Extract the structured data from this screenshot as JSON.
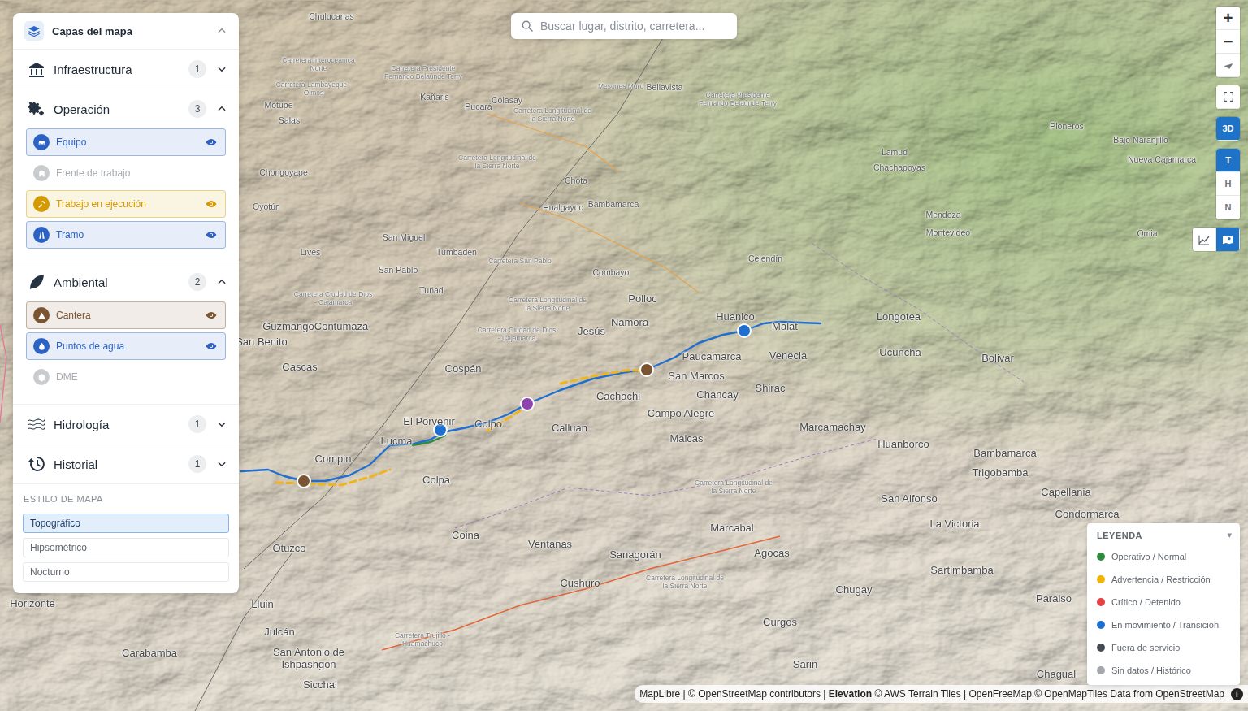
{
  "search": {
    "placeholder": "Buscar lugar, distrito, carretera..."
  },
  "layers_panel": {
    "title": "Capas del mapa",
    "expanded": true,
    "groups": [
      {
        "name": "Infraestructura",
        "count": "1",
        "expanded": false,
        "items": []
      },
      {
        "name": "Operación",
        "count": "3",
        "expanded": true,
        "items": [
          {
            "label": "Equipo",
            "on": true,
            "color": "#2c62c4"
          },
          {
            "label": "Frente de trabajo",
            "on": false,
            "color": "#b5b8bc"
          },
          {
            "label": "Trabajo en ejecución",
            "on": true,
            "color": "#d49a00"
          },
          {
            "label": "Tramo",
            "on": true,
            "color": "#2c62c4"
          }
        ]
      },
      {
        "name": "Ambiental",
        "count": "2",
        "expanded": true,
        "items": [
          {
            "label": "Cantera",
            "on": true,
            "color": "#7b5531"
          },
          {
            "label": "Puntos de agua",
            "on": true,
            "color": "#2c62c4"
          },
          {
            "label": "DME",
            "on": false,
            "color": "#b5b8bc"
          }
        ]
      },
      {
        "name": "Hidrología",
        "count": "1",
        "expanded": false,
        "items": []
      },
      {
        "name": "Historial",
        "count": "1",
        "expanded": false,
        "items": []
      }
    ],
    "map_style": {
      "title": "ESTILO DE MAPA",
      "options": [
        {
          "label": "Topográfico",
          "selected": true
        },
        {
          "label": "Hipsométrico",
          "selected": false
        },
        {
          "label": "Nocturno",
          "selected": false
        }
      ]
    }
  },
  "map_controls": {
    "zoom_in": "+",
    "zoom_out": "−",
    "modes": [
      {
        "label": "3D",
        "selected": true
      }
    ],
    "terrain": [
      {
        "label": "T",
        "selected": true
      },
      {
        "label": "H",
        "selected": false
      },
      {
        "label": "N",
        "selected": false
      }
    ],
    "tools": [
      {
        "selected": false
      },
      {
        "selected": true
      }
    ]
  },
  "legend": {
    "title": "LEYENDA",
    "toggle": "▾",
    "items": [
      {
        "label": "Operativo / Normal",
        "color": "#2e8b3e"
      },
      {
        "label": "Advertencia / Restricción",
        "color": "#f0b400"
      },
      {
        "label": "Crítico / Detenido",
        "color": "#e04444"
      },
      {
        "label": "En movimiento / Transición",
        "color": "#1f6fd0"
      },
      {
        "label": "Fuera de servicio",
        "color": "#454c56"
      },
      {
        "label": "Sin datos / Histórico",
        "color": "#a3a6aa"
      }
    ]
  },
  "attribution": {
    "parts": [
      {
        "text": "MapLibre | © OpenStreetMap contributors | ",
        "bold": false
      },
      {
        "text": "Elevation",
        "bold": true
      },
      {
        "text": " © AWS Terrain Tiles | OpenFreeMap © OpenMapTiles Data from OpenStreetMap",
        "bold": false
      }
    ],
    "info": "i"
  },
  "map": {
    "markers": [
      {
        "color": "#7b5531"
      },
      {
        "color": "#1f6fd0"
      },
      {
        "color": "#8e44ad"
      },
      {
        "color": "#7b5531"
      },
      {
        "color": "#1f6fd0"
      }
    ],
    "routes": [
      {
        "color": "#1f6fd0",
        "kind": "solid"
      },
      {
        "color": "#f0b41c",
        "kind": "dashed"
      },
      {
        "color": "#f0b41c",
        "kind": "dashed"
      },
      {
        "color": "#f0b41c",
        "kind": "dashed"
      },
      {
        "color": "#2e8b3e",
        "kind": "solid"
      }
    ],
    "labels": [
      {
        "text": "Chulucanas",
        "kind": "minor"
      },
      {
        "text": "Carretera Interoceánica Norte",
        "kind": "road"
      },
      {
        "text": "Carretera Presidente Fernando Belaúnde Terry",
        "kind": "road"
      },
      {
        "text": "Carretera Lambayeque - Olmos",
        "kind": "road"
      },
      {
        "text": "Kañaris",
        "kind": "minor"
      },
      {
        "text": "Motupe",
        "kind": "minor"
      },
      {
        "text": "Colasay",
        "kind": "minor"
      },
      {
        "text": "Pucará",
        "kind": "minor"
      },
      {
        "text": "Carretera Longitudinal de la Sierra Norte",
        "kind": "road"
      },
      {
        "text": "Mesones Muro",
        "kind": "road"
      },
      {
        "text": "Bellavista",
        "kind": "minor"
      },
      {
        "text": "Carretera Presidente Fernando Belaúnde Terry",
        "kind": "road"
      },
      {
        "text": "Salas",
        "kind": "minor"
      },
      {
        "text": "Pioneros",
        "kind": "minor"
      },
      {
        "text": "Bajo Naranjillo",
        "kind": "minor"
      },
      {
        "text": "Nueva Cajamarca",
        "kind": "minor"
      },
      {
        "text": "Lamud",
        "kind": "minor"
      },
      {
        "text": "Chachapoyas",
        "kind": "minor"
      },
      {
        "text": "Chongoyape",
        "kind": "minor"
      },
      {
        "text": "Carretera Longitudinal de la Sierra Norte",
        "kind": "road"
      },
      {
        "text": "Chota",
        "kind": "minor"
      },
      {
        "text": "Hualgayoc",
        "kind": "minor"
      },
      {
        "text": "Bambamarca",
        "kind": "minor"
      },
      {
        "text": "Oyotún",
        "kind": "minor"
      },
      {
        "text": "Mendoza",
        "kind": "minor"
      },
      {
        "text": "Montevideo",
        "kind": "minor"
      },
      {
        "text": "Omia",
        "kind": "minor"
      },
      {
        "text": "San Miguel",
        "kind": "minor"
      },
      {
        "text": "Tumbaden",
        "kind": "minor"
      },
      {
        "text": "Carretera San Pablo",
        "kind": "road"
      },
      {
        "text": "Lives",
        "kind": "minor"
      },
      {
        "text": "Celendín",
        "kind": "minor"
      },
      {
        "text": "San Pablo",
        "kind": "minor"
      },
      {
        "text": "Combayo",
        "kind": "minor"
      },
      {
        "text": "Tuñad",
        "kind": "minor"
      },
      {
        "text": "Carretera Ciudad de Dios - Cajamarca",
        "kind": "road"
      },
      {
        "text": "Polloc",
        "kind": "place"
      },
      {
        "text": "Carretera Longitudinal de la Sierra Norte",
        "kind": "road"
      },
      {
        "text": "Guzmango",
        "kind": "place"
      },
      {
        "text": "Contumazá",
        "kind": "place"
      },
      {
        "text": "Namora",
        "kind": "place"
      },
      {
        "text": "Huanico",
        "kind": "place"
      },
      {
        "text": "Malat",
        "kind": "place"
      },
      {
        "text": "Longotea",
        "kind": "place"
      },
      {
        "text": "Jesús",
        "kind": "place"
      },
      {
        "text": "Carretera Ciudad de Dios - Cajamarca",
        "kind": "road"
      },
      {
        "text": "San Benito",
        "kind": "place"
      },
      {
        "text": "Paucamarca",
        "kind": "place"
      },
      {
        "text": "Venecia",
        "kind": "place"
      },
      {
        "text": "Ucuncha",
        "kind": "place"
      },
      {
        "text": "Bolivar",
        "kind": "place"
      },
      {
        "text": "Cospán",
        "kind": "place"
      },
      {
        "text": "Cascas",
        "kind": "place"
      },
      {
        "text": "San Marcos",
        "kind": "place"
      },
      {
        "text": "Shirac",
        "kind": "place"
      },
      {
        "text": "Chancay",
        "kind": "place"
      },
      {
        "text": "Cachachi",
        "kind": "place"
      },
      {
        "text": "Campo Alegre",
        "kind": "place"
      },
      {
        "text": "El Porvenir",
        "kind": "place"
      },
      {
        "text": "Colpo",
        "kind": "place"
      },
      {
        "text": "Calluan",
        "kind": "place"
      },
      {
        "text": "Lucma",
        "kind": "place"
      },
      {
        "text": "Marcamachay",
        "kind": "place"
      },
      {
        "text": "Malcas",
        "kind": "place"
      },
      {
        "text": "Huanborco",
        "kind": "place"
      },
      {
        "text": "Bambamarca",
        "kind": "place"
      },
      {
        "text": "Trigobamba",
        "kind": "place"
      },
      {
        "text": "Compin",
        "kind": "place"
      },
      {
        "text": "Colpa",
        "kind": "place"
      },
      {
        "text": "Carretera Longitudinal de la Sierra Norte",
        "kind": "road"
      },
      {
        "text": "San Alfonso",
        "kind": "place"
      },
      {
        "text": "Capellania",
        "kind": "place"
      },
      {
        "text": "Condormarca",
        "kind": "place"
      },
      {
        "text": "La Victoria",
        "kind": "place"
      },
      {
        "text": "Marcabal",
        "kind": "place"
      },
      {
        "text": "Coina",
        "kind": "place"
      },
      {
        "text": "Otuzco",
        "kind": "place"
      },
      {
        "text": "Ventanas",
        "kind": "place"
      },
      {
        "text": "Agocas",
        "kind": "place"
      },
      {
        "text": "Sanagorán",
        "kind": "place"
      },
      {
        "text": "Sartimbamba",
        "kind": "place"
      },
      {
        "text": "Carretera Longitudinal de la Sierra Norte",
        "kind": "road"
      },
      {
        "text": "Cushuro",
        "kind": "place"
      },
      {
        "text": "Chugay",
        "kind": "place"
      },
      {
        "text": "Paraiso",
        "kind": "place"
      },
      {
        "text": "Horizonte",
        "kind": "place"
      },
      {
        "text": "Lluin",
        "kind": "place"
      },
      {
        "text": "Julcán",
        "kind": "place"
      },
      {
        "text": "Carretera Trujillo - Huamachuco",
        "kind": "road"
      },
      {
        "text": "Curgos",
        "kind": "place"
      },
      {
        "text": "Carabamba",
        "kind": "place"
      },
      {
        "text": "San Antonio de Ishpashgon",
        "kind": "place"
      },
      {
        "text": "Sarin",
        "kind": "place"
      },
      {
        "text": "Sicchal",
        "kind": "place"
      },
      {
        "text": "Chagual",
        "kind": "place"
      }
    ]
  }
}
